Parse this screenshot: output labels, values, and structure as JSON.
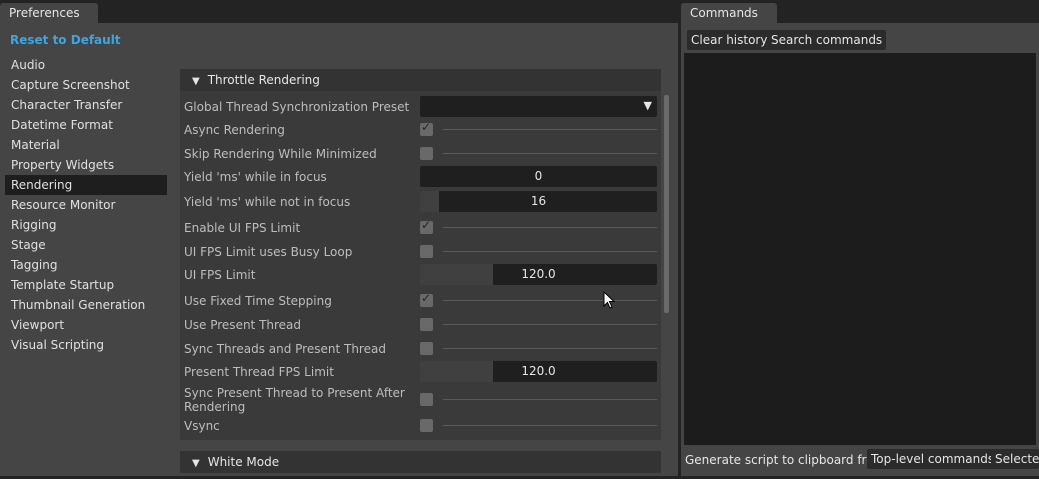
{
  "preferences": {
    "tab_label": "Preferences",
    "reset_label": "Reset to Default",
    "categories": [
      {
        "label": "Audio"
      },
      {
        "label": "Capture Screenshot"
      },
      {
        "label": "Character Transfer"
      },
      {
        "label": "Datetime Format"
      },
      {
        "label": "Material"
      },
      {
        "label": "Property Widgets"
      },
      {
        "label": "Rendering",
        "active": true
      },
      {
        "label": "Resource Monitor"
      },
      {
        "label": "Rigging"
      },
      {
        "label": "Stage"
      },
      {
        "label": "Tagging"
      },
      {
        "label": "Template Startup"
      },
      {
        "label": "Thumbnail Generation"
      },
      {
        "label": "Viewport"
      },
      {
        "label": "Visual Scripting"
      }
    ],
    "throttle": {
      "title": "Throttle Rendering",
      "rows": {
        "preset": {
          "label": "Global Thread Synchronization Preset",
          "value": ""
        },
        "async": {
          "label": "Async Rendering",
          "checked": true
        },
        "skip_min": {
          "label": "Skip Rendering While Minimized",
          "checked": false
        },
        "yield_focus": {
          "label": "Yield 'ms' while in focus",
          "value": "0",
          "fill_fraction": 0.0
        },
        "yield_nofocus": {
          "label": "Yield 'ms' while not in focus",
          "value": "16",
          "fill_fraction": 0.08
        },
        "ui_fps_enable": {
          "label": "Enable UI FPS Limit",
          "checked": true
        },
        "busy_loop": {
          "label": "UI FPS Limit uses Busy Loop",
          "checked": false
        },
        "ui_fps": {
          "label": "UI FPS Limit",
          "value": "120.0",
          "fill_fraction": 0.31
        },
        "fixed_step": {
          "label": "Use Fixed Time Stepping",
          "checked": true
        },
        "present_thread": {
          "label": "Use Present Thread",
          "checked": false
        },
        "sync_present": {
          "label": "Sync Threads and Present Thread",
          "checked": false
        },
        "present_fps": {
          "label": "Present Thread FPS Limit",
          "value": "120.0",
          "fill_fraction": 0.31
        },
        "sync_after": {
          "label": "Sync Present Thread to Present After Rendering",
          "checked": false
        },
        "vsync": {
          "label": "Vsync",
          "checked": false
        }
      }
    },
    "white_mode": {
      "title": "White Mode"
    }
  },
  "commands": {
    "tab_label": "Commands",
    "clear_history": "Clear history",
    "search_commands": "Search commands",
    "generate_label": "Generate script to clipboard from:",
    "top_level": "Top-level commands",
    "selected": "Selected"
  },
  "colors": {
    "accent_link": "#3ea5e0",
    "background": "#454545",
    "field": "#1f1f1f"
  }
}
